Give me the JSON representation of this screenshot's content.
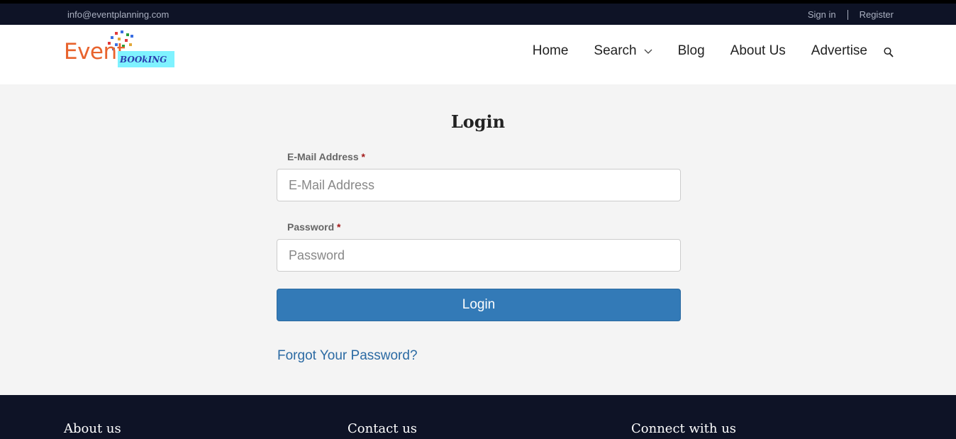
{
  "topbar": {
    "email": "info@eventplanning.com",
    "signin": "Sign in",
    "register": "Register"
  },
  "logo": {
    "word": "Event",
    "badge": "BOOkING"
  },
  "nav": {
    "items": [
      "Home",
      "Search",
      "Blog",
      "About Us",
      "Advertise"
    ]
  },
  "login": {
    "title": "Login",
    "email_label": "E-Mail Address",
    "email_placeholder": "E-Mail Address",
    "password_label": "Password",
    "password_placeholder": "Password",
    "required_mark": "*",
    "button": "Login",
    "forgot": "Forgot Your Password?"
  },
  "footer": {
    "about": "About us",
    "contact": "Contact us",
    "connect": "Connect with us"
  },
  "colors": {
    "topbar_bg": "#0e1326",
    "primary": "#337ab7",
    "logo_orange": "#e8632d",
    "required": "#a31a1a"
  }
}
